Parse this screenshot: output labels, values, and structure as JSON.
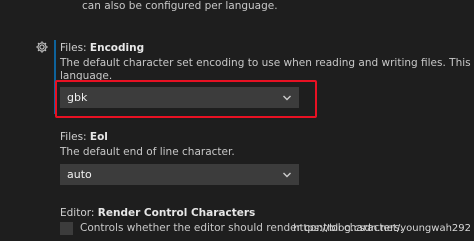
{
  "top_desc": "can also be configured per language.",
  "encoding": {
    "title_prefix": "Files: ",
    "title_name": "Encoding",
    "description_line1": "The default character set encoding to use when reading and writing files. This setting can also be",
    "description_line2": "language.",
    "value": "gbk",
    "gear_icon": "gear-icon",
    "dropdown_icon": "chevron-down-icon",
    "highlight_color": "#e81123"
  },
  "eol": {
    "title_prefix": "Files: ",
    "title_name": "Eol",
    "description": "The default end of line character.",
    "value": "auto",
    "dropdown_icon": "chevron-down-icon"
  },
  "render_control": {
    "title_prefix": "Editor: ",
    "title_name": "Render Control Characters",
    "description": "Controls whether the editor should render control characters."
  },
  "watermark": "https://blog.csdn.net/youngwah292",
  "colors": {
    "background": "#1e1e1e",
    "input_background": "#3c3c3c",
    "accent": "#0e639c"
  }
}
